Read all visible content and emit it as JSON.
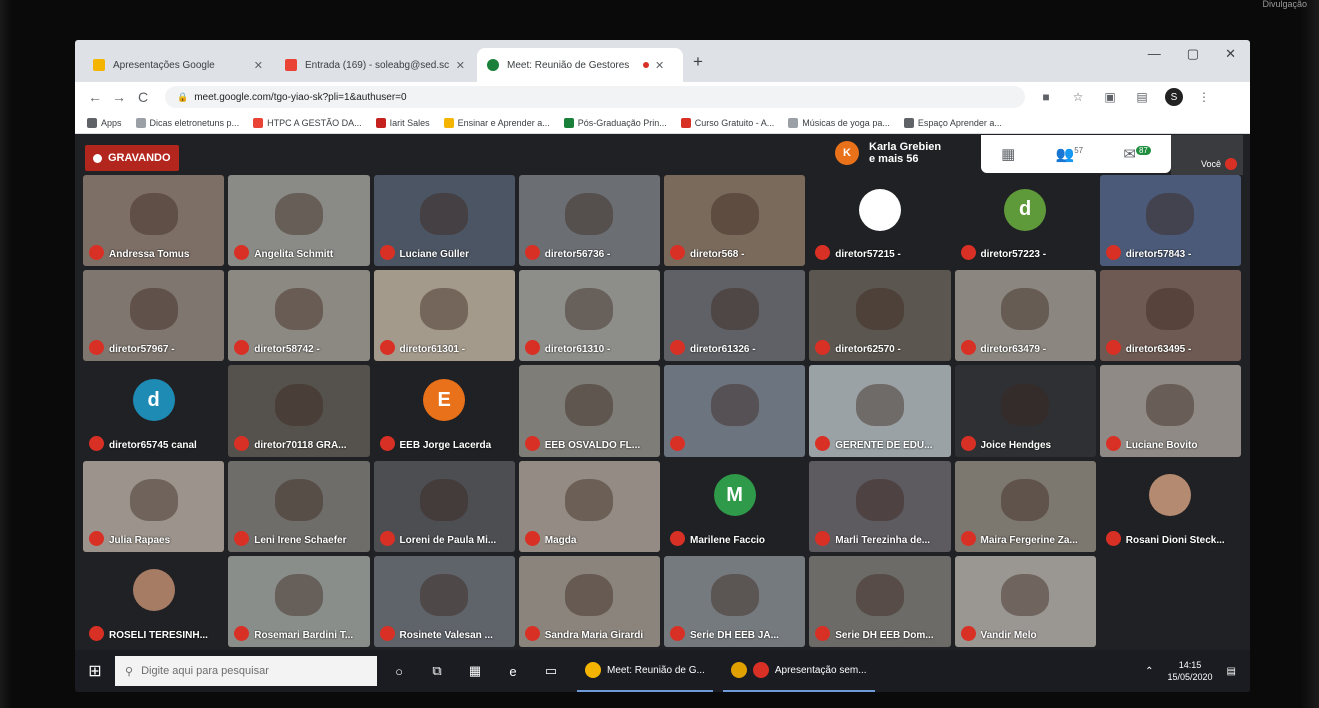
{
  "credit": "Divulgação",
  "tabs": [
    {
      "label": "Apresentações Google",
      "color": "#f4b400"
    },
    {
      "label": "Entrada (169) - soleabg@sed.sc",
      "color": "#ea4335"
    },
    {
      "label": "Meet: Reunião de Gestores",
      "color": "#188038"
    }
  ],
  "new_tab": "+",
  "window_controls": [
    "—",
    "▢",
    "✕"
  ],
  "toolbar": {
    "back": "←",
    "forward": "→",
    "reload": "C",
    "url": "meet.google.com/tgo-yiao-sk?pli=1&authuser=0",
    "profile_initial": "S"
  },
  "bookmarks": [
    {
      "label": "Apps",
      "color": "#5f6368"
    },
    {
      "label": "Dicas eletronetuns p...",
      "color": "#9aa0a6"
    },
    {
      "label": "HTPC A GESTÃO DA...",
      "color": "#ea4335"
    },
    {
      "label": "Iarit Sales",
      "color": "#c5221f"
    },
    {
      "label": "Ensinar e Aprender a...",
      "color": "#f4b400"
    },
    {
      "label": "Pós-Graduação Prin...",
      "color": "#188038"
    },
    {
      "label": "Curso Gratuito - A...",
      "color": "#d93025"
    },
    {
      "label": "Músicas de yoga pa...",
      "color": "#9aa0a6"
    },
    {
      "label": "Espaço Aprender a...",
      "color": "#5f6368"
    }
  ],
  "meet": {
    "recording_label": "GRAVANDO",
    "presenter_initial": "K",
    "presenter_line1": "Karla Grebien",
    "presenter_line2": "e mais 56",
    "people_count": "57",
    "chat_count": "87",
    "self_label": "Você"
  },
  "participants": [
    {
      "name": "Andressa Tomus",
      "initial": "",
      "color": "#7d6f66"
    },
    {
      "name": "Angelita Schmitt",
      "initial": "",
      "color": "#8a8b86"
    },
    {
      "name": "Luciane Güller",
      "initial": "",
      "color": "#4b5563"
    },
    {
      "name": "diretor56736 -",
      "initial": "",
      "color": "#6b6f74"
    },
    {
      "name": "diretor568 -",
      "initial": "",
      "color": "#7a6a5c"
    },
    {
      "name": "diretor57215 -",
      "initial": "",
      "color": "#202124",
      "avatar": "#ffffff"
    },
    {
      "name": "diretor57223 -",
      "initial": "d",
      "color": "#202124",
      "avatar": "#5f9a3a"
    },
    {
      "name": "diretor57843 -",
      "initial": "",
      "color": "#4a5a78"
    },
    {
      "name": "diretor57967 -",
      "initial": "",
      "color": "#7f766f"
    },
    {
      "name": "diretor58742 -",
      "initial": "",
      "color": "#8c8882"
    },
    {
      "name": "diretor61301 -",
      "initial": "",
      "color": "#a49a8c"
    },
    {
      "name": "diretor61310 -",
      "initial": "",
      "color": "#8d8e8a"
    },
    {
      "name": "diretor61326 -",
      "initial": "",
      "color": "#5f6166"
    },
    {
      "name": "diretor62570 -",
      "initial": "",
      "color": "#5b5750"
    },
    {
      "name": "diretor63479 -",
      "initial": "",
      "color": "#8b8780"
    },
    {
      "name": "diretor63495 -",
      "initial": "",
      "color": "#6e5a52"
    },
    {
      "name": "diretor65745 canal",
      "initial": "d",
      "color": "#202124",
      "avatar": "#1e8bb5"
    },
    {
      "name": "diretor70118 GRA...",
      "initial": "",
      "color": "#55524d"
    },
    {
      "name": "EEB Jorge Lacerda",
      "initial": "E",
      "color": "#202124",
      "avatar": "#e8711a"
    },
    {
      "name": "EEB OSVALDO FL...",
      "initial": "",
      "color": "#7e7d78"
    },
    {
      "name": "",
      "initial": "",
      "color": "#6c7480"
    },
    {
      "name": "GERENTE DE EDU...",
      "initial": "",
      "color": "#9aa2a6"
    },
    {
      "name": "Joice Hendges",
      "initial": "",
      "color": "#2f3033"
    },
    {
      "name": "Luciane Bovito",
      "initial": "",
      "color": "#8f8a85"
    },
    {
      "name": "Julia Rapaes",
      "initial": "",
      "color": "#9c948c"
    },
    {
      "name": "Leni Irene Schaefer",
      "initial": "",
      "color": "#6f6d6a"
    },
    {
      "name": "Loreni de Paula Mi...",
      "initial": "",
      "color": "#4c4e52"
    },
    {
      "name": "Magda",
      "initial": "",
      "color": "#948c84"
    },
    {
      "name": "Marilene Faccio",
      "initial": "M",
      "color": "#202124",
      "avatar": "#2e9a4a"
    },
    {
      "name": "Marli Terezinha de...",
      "initial": "",
      "color": "#5d5a60"
    },
    {
      "name": "Maira Fergerine Za...",
      "initial": "",
      "color": "#7c776f"
    },
    {
      "name": "Rosani Dioni Steck...",
      "initial": "",
      "color": "#202124",
      "avatar": "#b48a70"
    },
    {
      "name": "ROSELI TERESINH...",
      "initial": "",
      "color": "#202124",
      "avatar": "#a67c64"
    },
    {
      "name": "Rosemari Bardini T...",
      "initial": "",
      "color": "#8a8e8a"
    },
    {
      "name": "Rosinete Valesan ...",
      "initial": "",
      "color": "#5f636a"
    },
    {
      "name": "Sandra Maria Girardi",
      "initial": "",
      "color": "#8a847c"
    },
    {
      "name": "Serie DH EEB JA...",
      "initial": "",
      "color": "#757a7e"
    },
    {
      "name": "Serie DH EEB Dom...",
      "initial": "",
      "color": "#6d6b68"
    },
    {
      "name": "Vandir Melo",
      "initial": "",
      "color": "#9a9692"
    }
  ],
  "taskbar": {
    "start": "⊞",
    "search_placeholder": "Digite aqui para pesquisar",
    "apps": [
      "Meet: Reunião de G...",
      "Apresentação sem..."
    ],
    "time": "14:15",
    "date": "15/05/2020"
  }
}
